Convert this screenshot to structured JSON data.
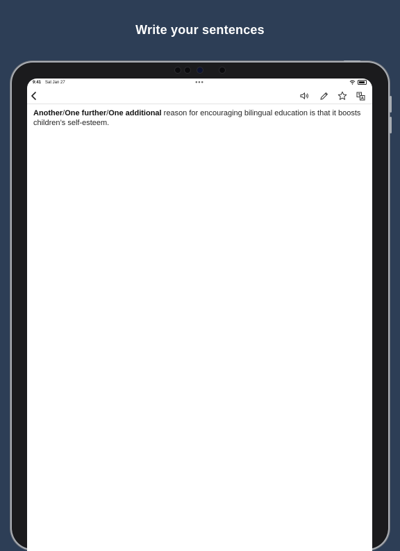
{
  "promo": {
    "title": "Write your sentences"
  },
  "status_bar": {
    "time": "9:41",
    "date": "Sat Jan 27",
    "dots": "•••"
  },
  "toolbar": {
    "back_icon": "chevron-left-icon",
    "icons": [
      "speaker-icon",
      "pencil-icon",
      "star-icon",
      "translate-icon"
    ]
  },
  "sentence": {
    "bold_1": "Another",
    "sep_1": "/",
    "bold_2": "One further",
    "sep_2": "/",
    "bold_3": "One additional",
    "rest": " reason for encouraging bilingual education is that it boosts children’s self-esteem."
  },
  "colors": {
    "background": "#2d3e56",
    "screen": "#ffffff",
    "text": "#262626"
  }
}
